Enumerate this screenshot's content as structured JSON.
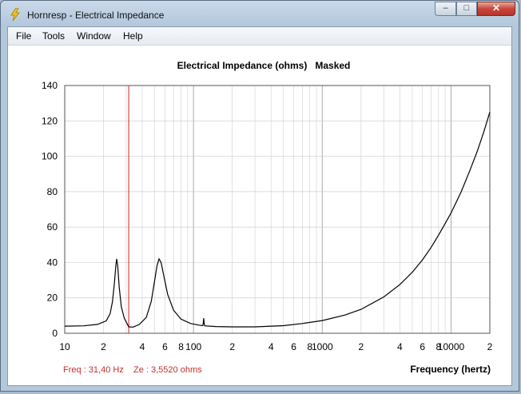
{
  "window": {
    "title": "Hornresp - Electrical Impedance",
    "icon": "lightning-icon",
    "controls": {
      "minimize": "–",
      "maximize": "□",
      "close": "✕"
    }
  },
  "menu": [
    {
      "label": "File"
    },
    {
      "label": "Tools"
    },
    {
      "label": "Window"
    },
    {
      "label": "Help"
    }
  ],
  "status": {
    "freq": "Freq : 31,40 Hz",
    "ze": "Ze : 3,5520 ohms",
    "color": "#c0322a"
  },
  "colors": {
    "curve": "#000000",
    "marker": "#cc2222",
    "grid": "#cfcfcf"
  },
  "chart_data": {
    "type": "line",
    "title": "Electrical Impedance (ohms)   Masked",
    "xlabel": "Frequency (hertz)",
    "ylabel": "",
    "x_scale": "log",
    "xlim": [
      10,
      20000
    ],
    "ylim": [
      0,
      140
    ],
    "y_ticks": [
      0,
      20,
      40,
      60,
      80,
      100,
      120,
      140
    ],
    "x_tick_labels": [
      {
        "x": 10,
        "label": "10"
      },
      {
        "x": 20,
        "label": "2"
      },
      {
        "x": 40,
        "label": "4"
      },
      {
        "x": 60,
        "label": "6"
      },
      {
        "x": 80,
        "label": "8"
      },
      {
        "x": 100,
        "label": "100"
      },
      {
        "x": 200,
        "label": "2"
      },
      {
        "x": 400,
        "label": "4"
      },
      {
        "x": 600,
        "label": "6"
      },
      {
        "x": 800,
        "label": "8"
      },
      {
        "x": 1000,
        "label": "1000"
      },
      {
        "x": 2000,
        "label": "2"
      },
      {
        "x": 4000,
        "label": "4"
      },
      {
        "x": 6000,
        "label": "6"
      },
      {
        "x": 8000,
        "label": "8"
      },
      {
        "x": 10000,
        "label": "10000"
      },
      {
        "x": 20000,
        "label": "2"
      }
    ],
    "marker_x": 31.4,
    "grid": true,
    "series": [
      {
        "values": [
          [
            10,
            4.0
          ],
          [
            14,
            4.2
          ],
          [
            18,
            5.0
          ],
          [
            21,
            7.0
          ],
          [
            22.5,
            11.0
          ],
          [
            23.5,
            18.0
          ],
          [
            24.3,
            28.0
          ],
          [
            24.9,
            38.0
          ],
          [
            25.3,
            42.0
          ],
          [
            25.8,
            38.0
          ],
          [
            26.5,
            26.0
          ],
          [
            27.5,
            15.0
          ],
          [
            29,
            8.5
          ],
          [
            31.4,
            3.6
          ],
          [
            34,
            3.5
          ],
          [
            38,
            5.0
          ],
          [
            43,
            9.0
          ],
          [
            47,
            18.0
          ],
          [
            50,
            30.0
          ],
          [
            52,
            38.0
          ],
          [
            54,
            42.0
          ],
          [
            56,
            40.0
          ],
          [
            59,
            32.0
          ],
          [
            63,
            22.0
          ],
          [
            70,
            13.0
          ],
          [
            80,
            8.0
          ],
          [
            95,
            5.5
          ],
          [
            110,
            4.6
          ],
          [
            118,
            4.3
          ],
          [
            119,
            5.5
          ],
          [
            120,
            8.5
          ],
          [
            121,
            5.5
          ],
          [
            122,
            4.2
          ],
          [
            150,
            3.8
          ],
          [
            200,
            3.6
          ],
          [
            300,
            3.6
          ],
          [
            500,
            4.3
          ],
          [
            700,
            5.5
          ],
          [
            1000,
            7.2
          ],
          [
            1500,
            10.3
          ],
          [
            2000,
            13.5
          ],
          [
            3000,
            20.5
          ],
          [
            4000,
            27.5
          ],
          [
            5000,
            34.5
          ],
          [
            6000,
            41.5
          ],
          [
            7000,
            48.5
          ],
          [
            8000,
            55.5
          ],
          [
            9000,
            62.0
          ],
          [
            10000,
            68.0
          ],
          [
            12000,
            80.0
          ],
          [
            14000,
            92.0
          ],
          [
            16000,
            103.0
          ],
          [
            18000,
            114.0
          ],
          [
            20000,
            125.0
          ]
        ]
      }
    ]
  }
}
